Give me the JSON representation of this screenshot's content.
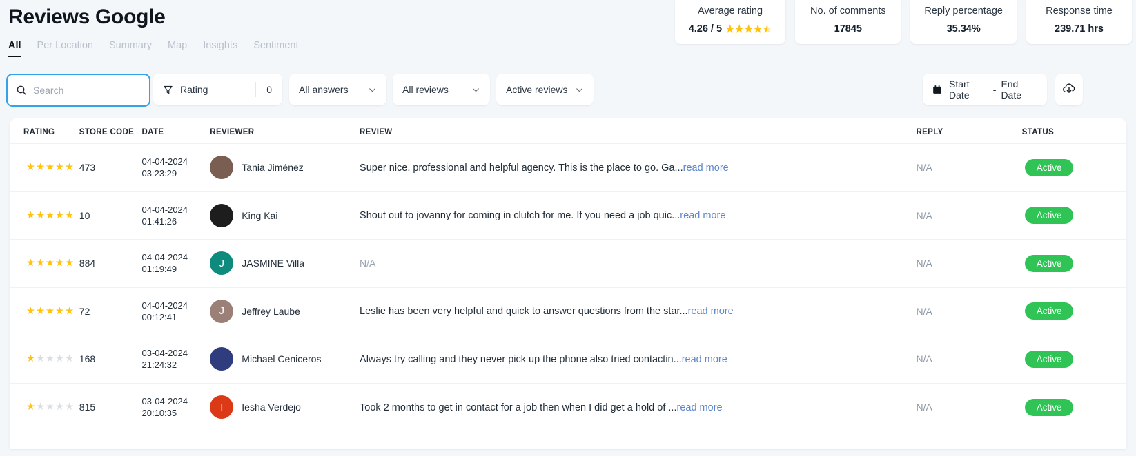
{
  "header": {
    "title": "Reviews Google",
    "tabs": [
      {
        "label": "All",
        "active": true
      },
      {
        "label": "Per Location",
        "active": false
      },
      {
        "label": "Summary",
        "active": false
      },
      {
        "label": "Map",
        "active": false
      },
      {
        "label": "Insights",
        "active": false
      },
      {
        "label": "Sentiment",
        "active": false
      }
    ]
  },
  "stats": [
    {
      "label": "Average rating",
      "value": "4.26 / 5",
      "stars": 4.26,
      "has_stars": true
    },
    {
      "label": "No. of comments",
      "value": "17845",
      "has_stars": false
    },
    {
      "label": "Reply percentage",
      "value": "35.34%",
      "has_stars": false
    },
    {
      "label": "Response time",
      "value": "239.71 hrs",
      "has_stars": false
    }
  ],
  "toolbar": {
    "search_placeholder": "Search",
    "search_value": "",
    "rating_label": "Rating",
    "rating_count": "0",
    "answers_select": "All answers",
    "reviews_select": "All reviews",
    "active_select": "Active reviews",
    "date_start": "Start Date",
    "date_separator": "-",
    "date_end": "End Date"
  },
  "table": {
    "columns": [
      "RATING",
      "STORE CODE",
      "DATE",
      "REVIEWER",
      "REVIEW",
      "REPLY",
      "STATUS"
    ],
    "rows": [
      {
        "rating": 5,
        "store_code": "473",
        "date": "04-04-2024",
        "time": "03:23:29",
        "reviewer": "Tania Jiménez",
        "avatar_type": "photo",
        "avatar_initial": "T",
        "avatar_color": "#7b5e52",
        "review": "Super nice, professional and helpful agency. This is the place to go. Ga...",
        "read_more": "read more",
        "reply": "N/A",
        "status": "Active"
      },
      {
        "rating": 5,
        "store_code": "10",
        "date": "04-04-2024",
        "time": "01:41:26",
        "reviewer": "King Kai",
        "avatar_type": "photo",
        "avatar_initial": "K",
        "avatar_color": "#1d1d1d",
        "review": "Shout out to jovanny for coming in clutch for me. If you need a job quic...",
        "read_more": "read more",
        "reply": "N/A",
        "status": "Active"
      },
      {
        "rating": 5,
        "store_code": "884",
        "date": "04-04-2024",
        "time": "01:19:49",
        "reviewer": "JASMINE Villa",
        "avatar_type": "initial",
        "avatar_initial": "J",
        "avatar_color": "#0f8b7e",
        "review": "N/A",
        "read_more": "",
        "reply": "N/A",
        "status": "Active"
      },
      {
        "rating": 5,
        "store_code": "72",
        "date": "04-04-2024",
        "time": "00:12:41",
        "reviewer": "Jeffrey Laube",
        "avatar_type": "initial",
        "avatar_initial": "J",
        "avatar_color": "#9b8078",
        "review": "Leslie has been very helpful and quick to answer questions from the star...",
        "read_more": "read more",
        "reply": "N/A",
        "status": "Active"
      },
      {
        "rating": 1,
        "store_code": "168",
        "date": "03-04-2024",
        "time": "21:24:32",
        "reviewer": "Michael Ceniceros",
        "avatar_type": "photo",
        "avatar_initial": "M",
        "avatar_color": "#2f3d7e",
        "review": "Always try calling and they never pick up the phone also tried contactin...",
        "read_more": "read more",
        "reply": "N/A",
        "status": "Active"
      },
      {
        "rating": 1,
        "store_code": "815",
        "date": "03-04-2024",
        "time": "20:10:35",
        "reviewer": "Iesha Verdejo",
        "avatar_type": "initial",
        "avatar_initial": "I",
        "avatar_color": "#dc3a16",
        "review": "Took 2 months to get in contact for a job then when I did get a hold of ...",
        "read_more": "read more",
        "reply": "N/A",
        "status": "Active"
      }
    ]
  },
  "colors": {
    "accent": "#35a2e8",
    "star": "#ffc20e",
    "star_empty": "#d9dee4",
    "badge_green": "#30c456",
    "link": "#5d86c9",
    "page_bg": "#f4f7fa"
  },
  "icons": {
    "search": "search-icon",
    "filter": "filter-icon",
    "chevron": "chevron-down-icon",
    "calendar": "calendar-icon",
    "download": "cloud-download-icon"
  }
}
